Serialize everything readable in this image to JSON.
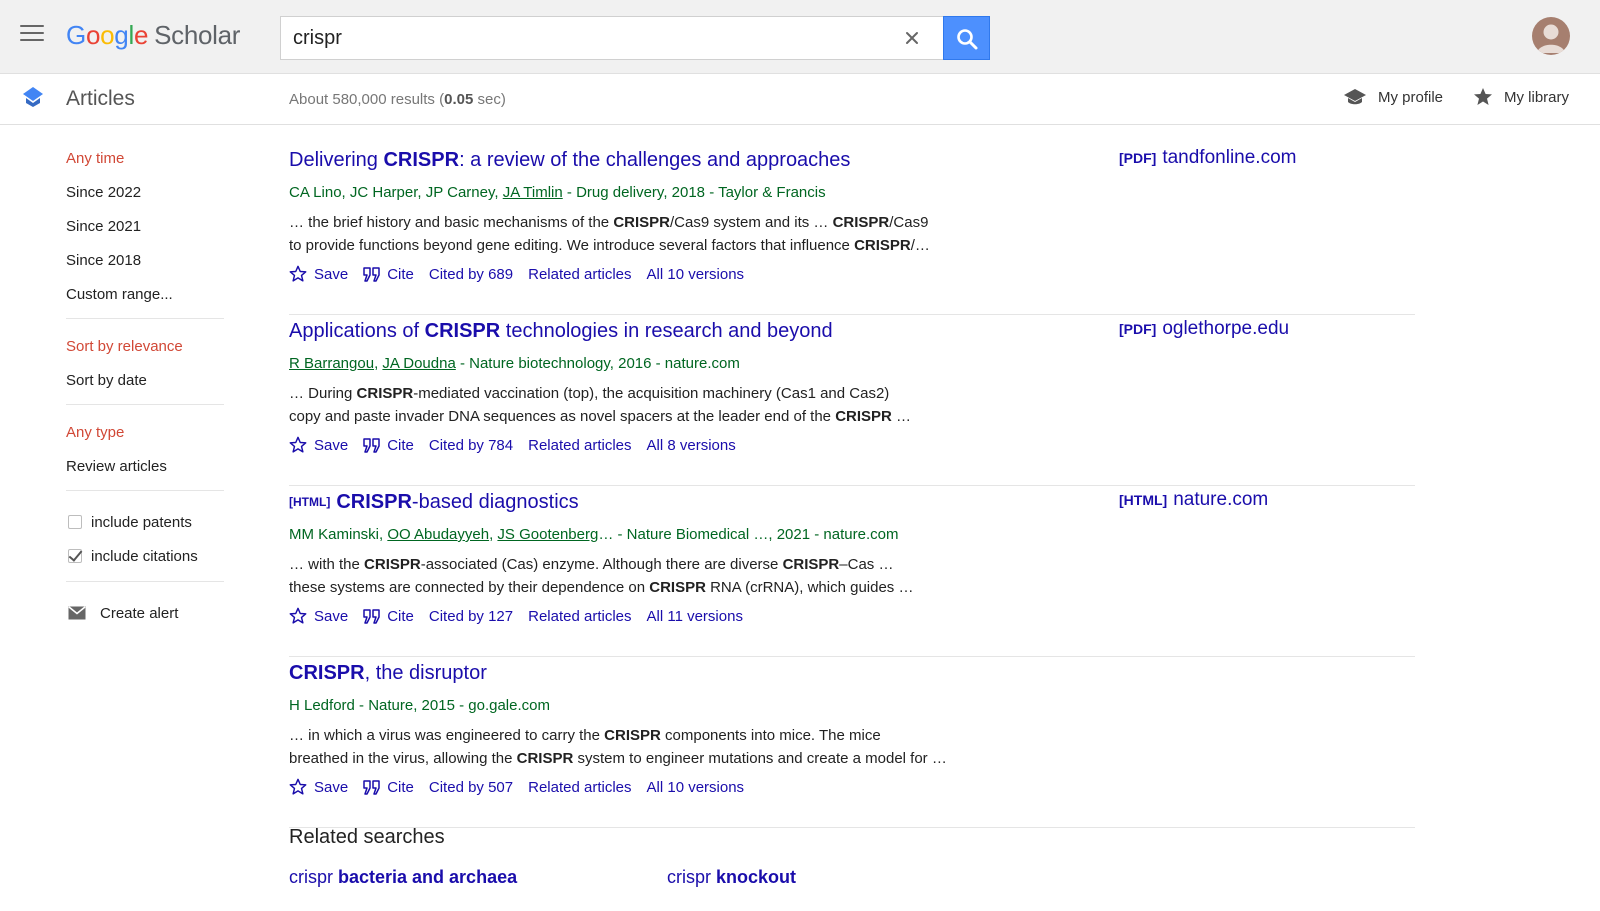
{
  "app": {
    "logo": {
      "g1": "G",
      "o1": "o",
      "o2": "o",
      "g2": "g",
      "l": "l",
      "e": "e",
      "scholar": "Scholar"
    }
  },
  "search": {
    "query": "crispr",
    "placeholder": ""
  },
  "subheader": {
    "section": "Articles",
    "results_prefix": "About 580,000 results (",
    "results_time": "0.05",
    "results_suffix": " sec)",
    "my_profile": "My profile",
    "my_library": "My library"
  },
  "sidebar": {
    "time_filters": [
      "Any time",
      "Since 2022",
      "Since 2021",
      "Since 2018",
      "Custom range..."
    ],
    "sort_options": [
      "Sort by relevance",
      "Sort by date"
    ],
    "type_options": [
      "Any type",
      "Review articles"
    ],
    "include_patents": "include patents",
    "include_citations": "include citations",
    "create_alert": "Create alert",
    "active_color": "#d14836"
  },
  "results": [
    {
      "title_pre": "Delivering ",
      "title_bold": "CRISPR",
      "title_post": ": a review of the challenges and approaches",
      "authors_plain": "CA Lino, JC Harper, JP Carney, ",
      "authors_link1": "JA Timlin",
      "authors_link2": "",
      "authors_link3": "",
      "authors_rest": " - Drug delivery, 2018 - Taylor & Francis",
      "snippet_line1": [
        "… the brief history and basic mechanisms of the ",
        "CRISPR",
        "/Cas9 system and its … ",
        "CRISPR",
        "/Cas9"
      ],
      "snippet_line2": [
        "to provide functions beyond gene editing. We introduce several factors that influence ",
        "CRISPR",
        "/…"
      ],
      "cited_by": "Cited by 689",
      "versions": "All 10 versions",
      "side_tag": "[PDF]",
      "side_link": "tandfonline.com"
    },
    {
      "title_pre": "Applications of ",
      "title_bold": "CRISPR",
      "title_post": " technologies in research and beyond",
      "authors_plain": "",
      "authors_link1": "R Barrangou",
      "authors_link2": "JA Doudna",
      "authors_rest": " - Nature biotechnology, 2016 - nature.com",
      "snippet_line1": [
        "… During ",
        "CRISPR",
        "-mediated vaccination (top), the acquisition machinery (Cas1 and Cas2)",
        "",
        ""
      ],
      "snippet_line2": [
        "copy and paste invader DNA sequences as novel spacers at the leader end of the ",
        "CRISPR",
        " …"
      ],
      "cited_by": "Cited by 784",
      "versions": "All 8 versions",
      "side_tag": "[PDF]",
      "side_link": "oglethorpe.edu"
    },
    {
      "title_tag": "[HTML]",
      "title_bold": "CRISPR",
      "title_post": "-based diagnostics",
      "authors_plain": "MM Kaminski, ",
      "authors_link1": "OO Abudayyeh",
      "authors_link2": "JS Gootenberg",
      "authors_rest": "… - Nature Biomedical …, 2021 - nature.com",
      "snippet_line1": [
        "… with the ",
        "CRISPR",
        "-associated (Cas) enzyme. Although there are diverse ",
        "CRISPR",
        "–Cas …"
      ],
      "snippet_line2": [
        "these systems are connected by their dependence on ",
        "CRISPR",
        " RNA (crRNA), which guides …"
      ],
      "cited_by": "Cited by 127",
      "versions": "All 11 versions",
      "side_tag": "[HTML]",
      "side_link": "nature.com"
    },
    {
      "title_bold": "CRISPR",
      "title_post": ", the disruptor",
      "authors_plain": "H Ledford",
      "authors_rest": " - Nature, 2015 - go.gale.com",
      "snippet_line1": [
        "… in which a virus was engineered to carry the ",
        "CRISPR",
        " components into mice. The mice",
        "",
        ""
      ],
      "snippet_line2": [
        "breathed in the virus, allowing the ",
        "CRISPR",
        " system to engineer mutations and create a model for …"
      ],
      "cited_by": "Cited by 507",
      "versions": "All 10 versions"
    }
  ],
  "actions": {
    "save": "Save",
    "cite": "Cite",
    "related": "Related articles"
  },
  "related_searches": {
    "title": "Related searches",
    "items": [
      {
        "plain": "crispr ",
        "bold": "bacteria and archaea"
      },
      {
        "plain": "crispr ",
        "bold": "knockout"
      }
    ]
  },
  "colors": {
    "link": "#1a0dab",
    "author_green": "#006621",
    "search_button": "#4d90fe"
  },
  "icons": [
    "menu-icon",
    "clear-icon",
    "search-icon",
    "avatar-icon",
    "articles-icon",
    "graduation-cap-icon",
    "star-icon",
    "save-star-icon",
    "cite-quote-icon",
    "mail-icon"
  ]
}
